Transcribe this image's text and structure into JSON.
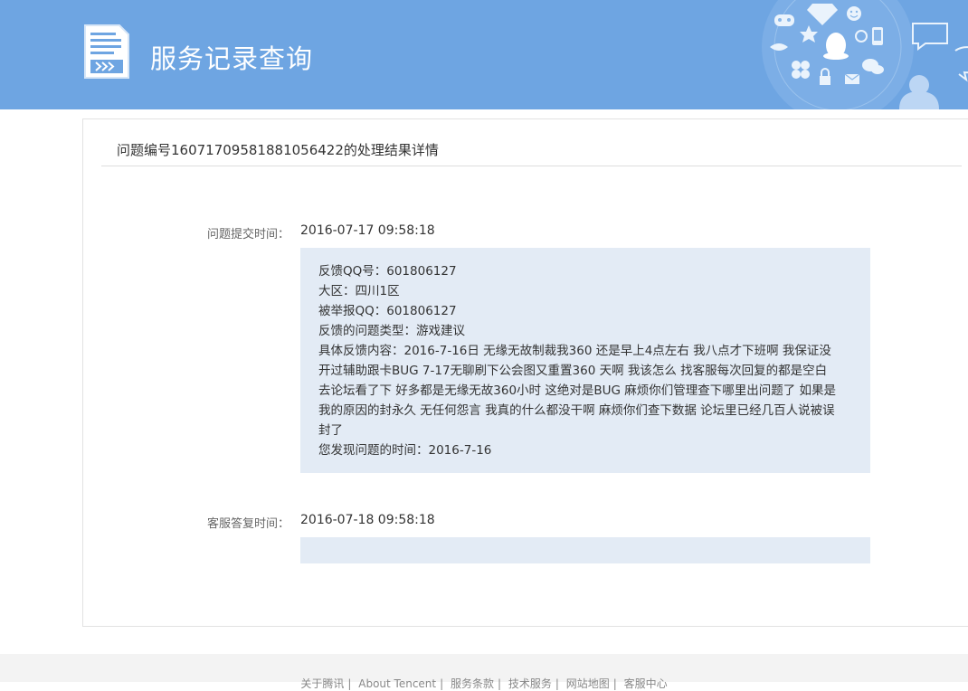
{
  "header": {
    "title": "服务记录查询"
  },
  "detail": {
    "title": "问题编号16071709581881056422的处理结果详情",
    "submit": {
      "label": "问题提交时间：",
      "time": "2016-07-17 09:58:18",
      "lines": [
        "反馈QQ号：601806127",
        "大区：四川1区",
        "被举报QQ：601806127",
        "反馈的问题类型：游戏建议",
        "具体反馈内容：2016-7-16日 无缘无故制裁我360 还是早上4点左右 我八点才下班啊 我保证没",
        "开过辅助跟卡BUG 7-17无聊刷下公会图又重置360 天啊 我该怎么 找客服每次回复的都是空白",
        "去论坛看了下 好多都是无缘无故360小时 这绝对是BUG 麻烦你们管理查下哪里出问题了 如果是",
        "我的原因的封永久 无任何怨言 我真的什么都没干啊 麻烦你们查下数据 论坛里已经几百人说被误",
        "封了",
        "您发现问题的时间：2016-7-16"
      ]
    },
    "reply": {
      "label": "客服答复时间：",
      "time": "2016-07-18 09:58:18"
    }
  },
  "footer": {
    "links": [
      "关于腾讯",
      "About Tencent",
      "服务条款",
      "技术服务",
      "网站地图",
      "客服中心"
    ]
  },
  "colors": {
    "header_bg": "#6ea5e2",
    "message_bg": "#e3ebf5",
    "footer_bg": "#f3f3f3"
  },
  "icons": [
    "document-icon",
    "gamepad-icon",
    "diamond-icon",
    "smiley-icon",
    "star-icon",
    "penguin-icon",
    "phone-icon",
    "clover-icon",
    "lock-icon",
    "mail-icon",
    "chat-bubble-icon",
    "user-silhouette-icon"
  ]
}
